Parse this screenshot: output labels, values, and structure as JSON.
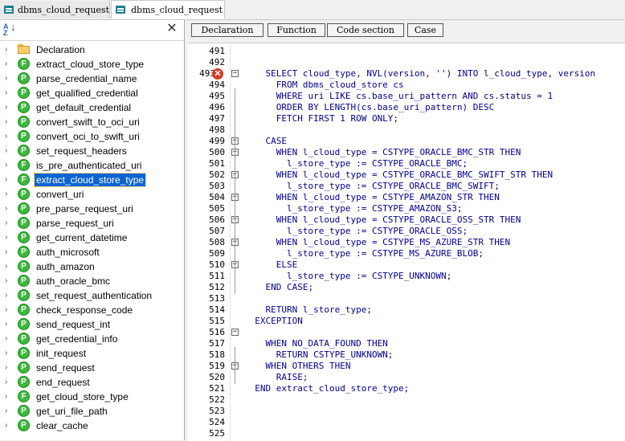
{
  "tabs": [
    {
      "label": "dbms_cloud_request",
      "active": false
    },
    {
      "label": "dbms_cloud_request",
      "active": true
    }
  ],
  "left_panel": {
    "items": [
      {
        "label": "Declaration",
        "icon": "folder-icon",
        "selected": false
      },
      {
        "label": "extract_cloud_store_type",
        "icon": "function-icon",
        "selected": false
      },
      {
        "label": "parse_credential_name",
        "icon": "procedure-icon",
        "selected": false
      },
      {
        "label": "get_qualified_credential",
        "icon": "procedure-icon",
        "selected": false
      },
      {
        "label": "get_default_credential",
        "icon": "procedure-icon",
        "selected": false
      },
      {
        "label": "convert_swift_to_oci_uri",
        "icon": "procedure-icon",
        "selected": false
      },
      {
        "label": "convert_oci_to_swift_uri",
        "icon": "procedure-icon",
        "selected": false
      },
      {
        "label": "set_request_headers",
        "icon": "procedure-icon",
        "selected": false
      },
      {
        "label": "is_pre_authenticated_uri",
        "icon": "function-icon",
        "selected": false
      },
      {
        "label": "extract_cloud_store_type",
        "icon": "function-icon",
        "selected": true
      },
      {
        "label": "convert_uri",
        "icon": "procedure-icon",
        "selected": false
      },
      {
        "label": "pre_parse_request_uri",
        "icon": "procedure-icon",
        "selected": false
      },
      {
        "label": "parse_request_uri",
        "icon": "procedure-icon",
        "selected": false
      },
      {
        "label": "get_current_datetime",
        "icon": "procedure-icon",
        "selected": false
      },
      {
        "label": "auth_microsoft",
        "icon": "procedure-icon",
        "selected": false
      },
      {
        "label": "auth_amazon",
        "icon": "procedure-icon",
        "selected": false
      },
      {
        "label": "auth_oracle_bmc",
        "icon": "procedure-icon",
        "selected": false
      },
      {
        "label": "set_request_authentication",
        "icon": "procedure-icon",
        "selected": false
      },
      {
        "label": "check_response_code",
        "icon": "procedure-icon",
        "selected": false
      },
      {
        "label": "send_request_int",
        "icon": "procedure-icon",
        "selected": false
      },
      {
        "label": "get_credential_info",
        "icon": "procedure-icon",
        "selected": false
      },
      {
        "label": "init_request",
        "icon": "procedure-icon",
        "selected": false
      },
      {
        "label": "send_request",
        "icon": "procedure-icon",
        "selected": false
      },
      {
        "label": "end_request",
        "icon": "procedure-icon",
        "selected": false
      },
      {
        "label": "get_cloud_store_type",
        "icon": "function-icon",
        "selected": false
      },
      {
        "label": "get_uri_file_path",
        "icon": "procedure-icon",
        "selected": false
      },
      {
        "label": "clear_cache",
        "icon": "procedure-icon",
        "selected": false
      }
    ]
  },
  "toolbar": {
    "buttons": [
      "Declaration",
      "Function",
      "Code section",
      "Case"
    ]
  },
  "editor": {
    "lines": [
      {
        "num": "491",
        "text": ""
      },
      {
        "num": "492",
        "text": ""
      },
      {
        "num": "493",
        "text": "    SELECT cloud_type, NVL(version, '') INTO l_cloud_type, version"
      },
      {
        "num": "494",
        "text": "      FROM dbms_cloud_store cs"
      },
      {
        "num": "495",
        "text": "      WHERE uri LIKE cs.base_uri_pattern AND cs.status = 1"
      },
      {
        "num": "496",
        "text": "      ORDER BY LENGTH(cs.base_uri_pattern) DESC"
      },
      {
        "num": "497",
        "text": "      FETCH FIRST 1 ROW ONLY;"
      },
      {
        "num": "498",
        "text": ""
      },
      {
        "num": "499",
        "text": "    CASE"
      },
      {
        "num": "500",
        "text": "      WHEN l_cloud_type = CSTYPE_ORACLE_BMC_STR THEN"
      },
      {
        "num": "501",
        "text": "        l_store_type := CSTYPE_ORACLE_BMC;"
      },
      {
        "num": "502",
        "text": "      WHEN l_cloud_type = CSTYPE_ORACLE_BMC_SWIFT_STR THEN"
      },
      {
        "num": "503",
        "text": "        l_store_type := CSTYPE_ORACLE_BMC_SWIFT;"
      },
      {
        "num": "504",
        "text": "      WHEN l_cloud_type = CSTYPE_AMAZON_STR THEN"
      },
      {
        "num": "505",
        "text": "        l_store_type := CSTYPE_AMAZON_S3;"
      },
      {
        "num": "506",
        "text": "      WHEN l_cloud_type = CSTYPE_ORACLE_OSS_STR THEN"
      },
      {
        "num": "507",
        "text": "        l_store_type := CSTYPE_ORACLE_OSS;"
      },
      {
        "num": "508",
        "text": "      WHEN l_cloud_type = CSTYPE_MS_AZURE_STR THEN"
      },
      {
        "num": "509",
        "text": "        l_store_type := CSTYPE_MS_AZURE_BLOB;"
      },
      {
        "num": "510",
        "text": "      ELSE"
      },
      {
        "num": "511",
        "text": "        l_store_type := CSTYPE_UNKNOWN;"
      },
      {
        "num": "512",
        "text": "    END CASE;"
      },
      {
        "num": "513",
        "text": ""
      },
      {
        "num": "514",
        "text": "    RETURN l_store_type;"
      },
      {
        "num": "515",
        "text": "  EXCEPTION"
      },
      {
        "num": "516",
        "text": ""
      },
      {
        "num": "517",
        "text": "    WHEN NO_DATA_FOUND THEN"
      },
      {
        "num": "518",
        "text": "      RETURN CSTYPE_UNKNOWN;"
      },
      {
        "num": "519",
        "text": "    WHEN OTHERS THEN"
      },
      {
        "num": "520",
        "text": "      RAISE;"
      },
      {
        "num": "521",
        "text": "  END extract_cloud_store_type;"
      },
      {
        "num": "522",
        "text": ""
      },
      {
        "num": "523",
        "text": ""
      },
      {
        "num": "524",
        "text": ""
      },
      {
        "num": "525",
        "text": ""
      }
    ],
    "error_line": "493",
    "fold_lines": [
      "493",
      "499",
      "500",
      "502",
      "504",
      "506",
      "508",
      "510",
      "516",
      "519"
    ]
  }
}
